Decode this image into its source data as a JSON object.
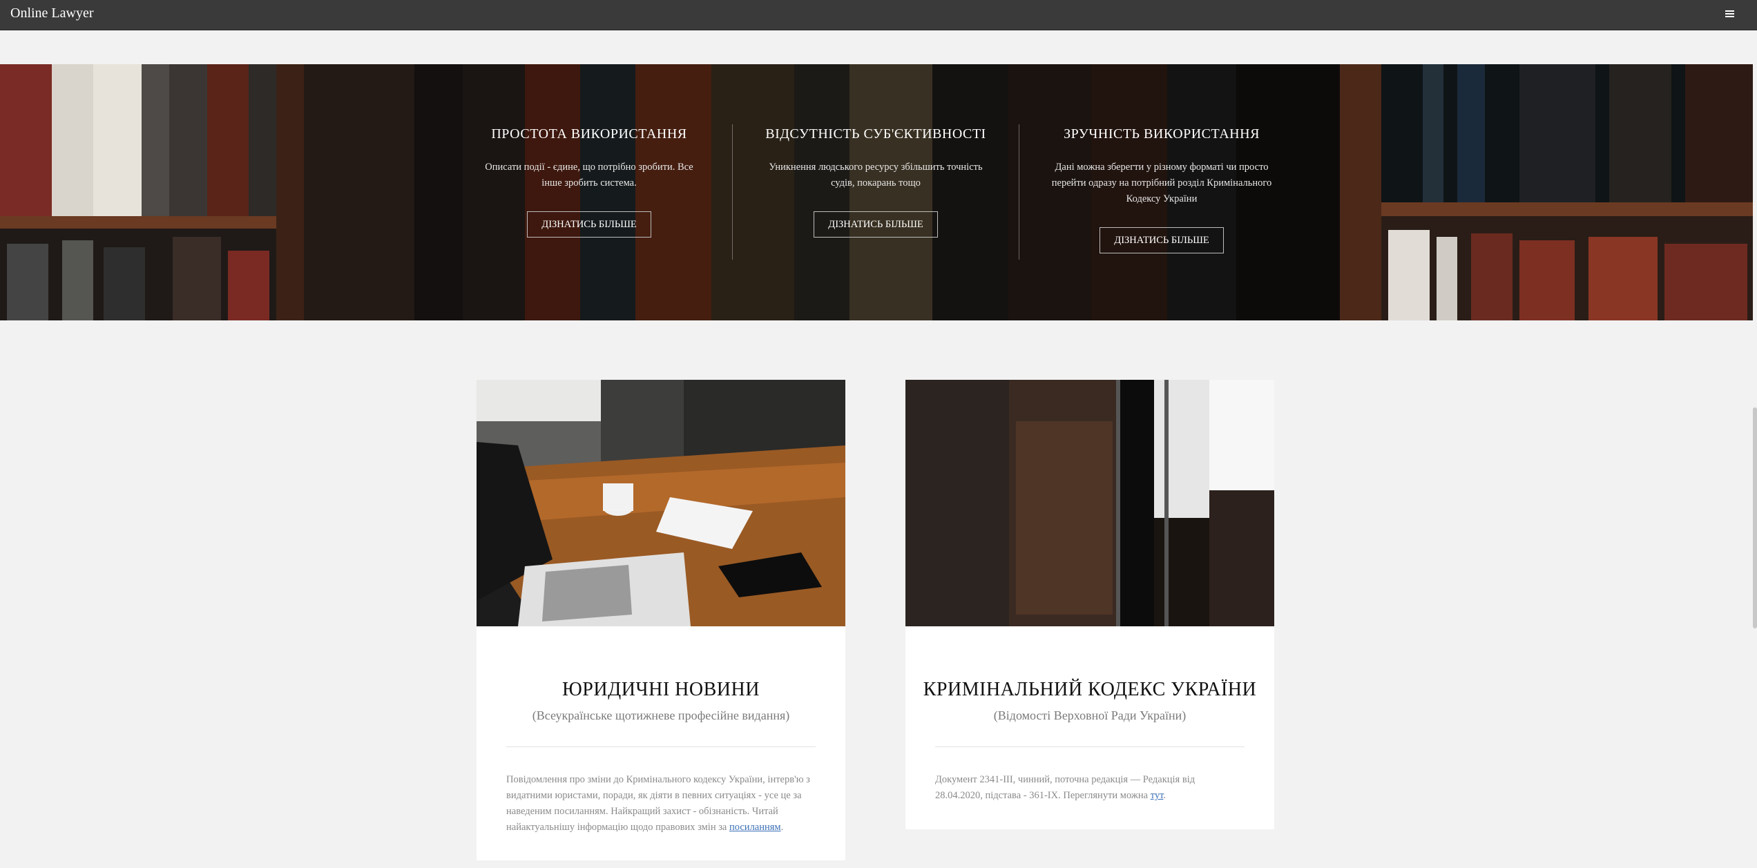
{
  "navbar": {
    "brand": "Online Lawyer",
    "menu_icon": "hamburger-menu-icon"
  },
  "features": [
    {
      "title": "ПРОСТОТА ВИКОРИСТАННЯ",
      "text_lines": [
        "Описати події - єдине, що потрібно зробити. Все",
        "інше зробить система."
      ],
      "button": "ДІЗНАТИСЬ БІЛЬШЕ"
    },
    {
      "title": "ВІДСУТНІСТЬ СУБ'ЄКТИВНОСТІ",
      "text_lines": [
        "Уникнення людського ресурсу збільшить точність",
        "судів, покарань тощо"
      ],
      "button": "ДІЗНАТИСЬ БІЛЬШЕ"
    },
    {
      "title": "ЗРУЧНІСТЬ ВИКОРИСТАННЯ",
      "text_lines": [
        "Дані можна зберегти у різному форматі чи просто",
        "перейти одразу на потрібний розділ Кримінального",
        "Кодексу України"
      ],
      "button": "ДІЗНАТИСЬ БІЛЬШЕ"
    }
  ],
  "cards": [
    {
      "title": "ЮРИДИЧНІ НОВИНИ",
      "subtitle": "(Всеукраїнське щотижневе професійне видання)",
      "body_lines": [
        "Повідомлення про зміни до Кримінального кодексу України, інтерв'ю з",
        "видатними юристами, поради, як діяти в певних ситуаціях - усе це за",
        "наведеним посиланням. Найкращий захист - обізнаність. Читай",
        "найактуальнішу інформацію щодо правових змін за "
      ],
      "link": "посиланням",
      "link_suffix": ".",
      "image": "laptop-desk-photo"
    },
    {
      "title": "КРИМІНАЛЬНИЙ КОДЕКС УКРАЇНИ",
      "subtitle": "(Відомості Верховної Ради України)",
      "body_lines": [
        "Документ 2341-III, чинний, поточна редакція — Редакція від",
        "28.04.2020, підстава - 361-IX. Переглянути можна "
      ],
      "link": "тут",
      "link_suffix": ".",
      "image": "library-shelves-photo"
    }
  ]
}
